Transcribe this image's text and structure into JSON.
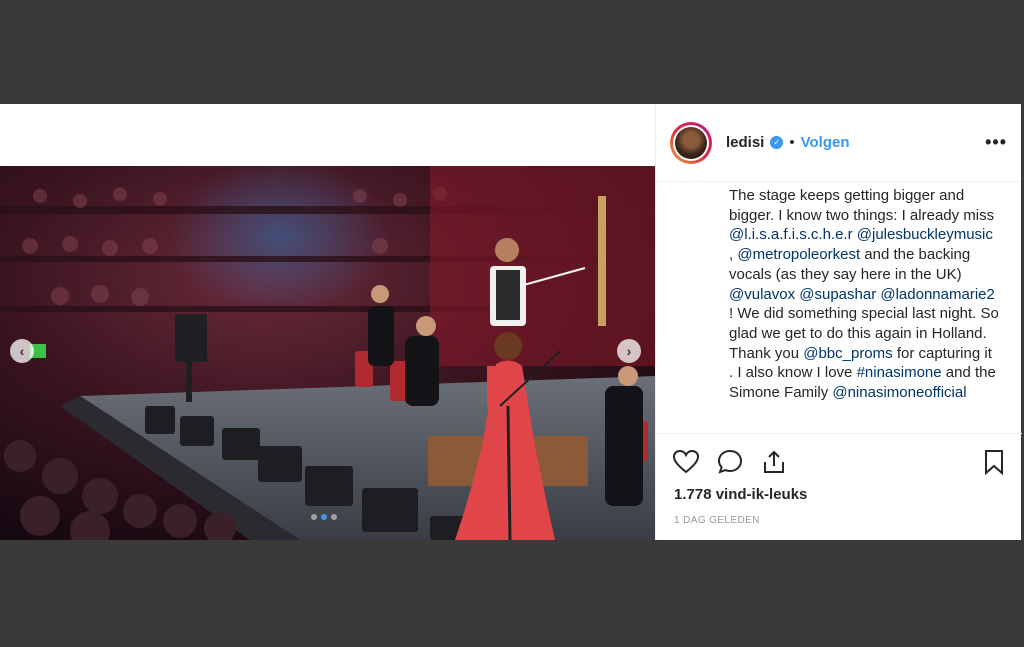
{
  "post": {
    "username": "ledisi",
    "follow_label": "Volgen",
    "separator": "•",
    "more_label": "•••",
    "caption": {
      "text_1": "The stage keeps getting bigger and bigger. I know two things: I already miss ",
      "mention_1": "@l.i.s.a.f.i.s.c.h.e.r",
      "mention_2": "@julesbuckleymusic",
      "text_2": " , ",
      "mention_3": "@metropoleorkest",
      "text_3": " and the backing vocals (as they say here in the UK) ",
      "mention_4": "@vulavox",
      "mention_5": "@supashar",
      "mention_6": "@ladonnamarie2",
      "text_4": " ! We did something special last night. So glad we get to do this again in Holland. Thank you ",
      "mention_7": "@bbc_proms",
      "text_5": " for capturing it . I also know I love ",
      "hashtag_1": "#ninasimone",
      "text_6": " and the Simone Family ",
      "mention_8": "@ninasimoneofficial"
    },
    "likes": "1.778 vind-ik-leuks",
    "timestamp": "1 DAG GELEDEN"
  },
  "carousel": {
    "prev_label": "‹",
    "next_label": "›",
    "dots": 3,
    "active_dot": 1
  },
  "icons": {
    "verified": "verified-badge-icon",
    "like": "heart-icon",
    "comment": "comment-icon",
    "share": "share-icon",
    "save": "bookmark-icon"
  },
  "colors": {
    "link": "#003569",
    "accent": "#3897f0",
    "background": "#3a3a3a"
  }
}
